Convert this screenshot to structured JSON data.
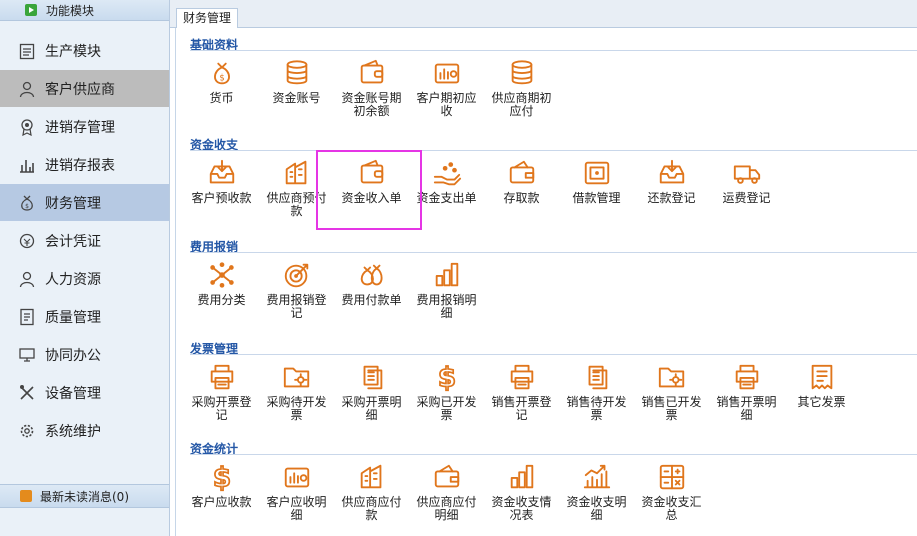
{
  "sidebar": {
    "header": "功能模块",
    "items": [
      {
        "label": "生产模块",
        "icon": "clipboard-icon"
      },
      {
        "label": "客户供应商",
        "icon": "person-icon"
      },
      {
        "label": "进销存管理",
        "icon": "medal-icon"
      },
      {
        "label": "进销存报表",
        "icon": "chart-icon"
      },
      {
        "label": "财务管理",
        "icon": "money-bag-icon"
      },
      {
        "label": "会计凭证",
        "icon": "coin-icon"
      },
      {
        "label": "人力资源",
        "icon": "person-icon"
      },
      {
        "label": "质量管理",
        "icon": "document-icon"
      },
      {
        "label": "协同办公",
        "icon": "monitor-icon"
      },
      {
        "label": "设备管理",
        "icon": "tools-icon"
      },
      {
        "label": "系统维护",
        "icon": "gear-icon"
      }
    ],
    "footer": "最新未读消息(0)"
  },
  "tab": {
    "label": "财务管理"
  },
  "sections": [
    {
      "title": "基础资料",
      "items": [
        {
          "line1": "货币",
          "line2": "",
          "icon": "money-bag-icon"
        },
        {
          "line1": "资金账号",
          "line2": "",
          "icon": "coin-stack-icon"
        },
        {
          "line1": "资金账号期",
          "line2": "初余额",
          "icon": "wallet-icon"
        },
        {
          "line1": "客户期初应",
          "line2": "收",
          "icon": "wallet-chart-icon"
        },
        {
          "line1": "供应商期初",
          "line2": "应付",
          "icon": "coin-stack-icon"
        }
      ]
    },
    {
      "title": "资金收支",
      "items": [
        {
          "line1": "客户预收款",
          "line2": "",
          "icon": "inbox-download-icon"
        },
        {
          "line1": "供应商预付",
          "line2": "款",
          "icon": "building-chart-icon"
        },
        {
          "line1": "资金收入单",
          "line2": "",
          "icon": "wallet-icon"
        },
        {
          "line1": "资金支出单",
          "line2": "",
          "icon": "hand-coins-icon"
        },
        {
          "line1": "存取款",
          "line2": "",
          "icon": "wallet-arrow-icon"
        },
        {
          "line1": "借款管理",
          "line2": "",
          "icon": "safe-icon"
        },
        {
          "line1": "还款登记",
          "line2": "",
          "icon": "inbox-download-icon"
        },
        {
          "line1": "运费登记",
          "line2": "",
          "icon": "truck-icon"
        }
      ]
    },
    {
      "title": "费用报销",
      "items": [
        {
          "line1": "费用分类",
          "line2": "",
          "icon": "network-icon"
        },
        {
          "line1": "费用报销登",
          "line2": "记",
          "icon": "target-icon"
        },
        {
          "line1": "费用付款单",
          "line2": "",
          "icon": "money-bags-icon"
        },
        {
          "line1": "费用报销明",
          "line2": "细",
          "icon": "bar-chart-icon"
        }
      ]
    },
    {
      "title": "发票管理",
      "items": [
        {
          "line1": "采购开票登",
          "line2": "记",
          "icon": "printer-icon"
        },
        {
          "line1": "采购待开发",
          "line2": "票",
          "icon": "folder-gear-icon"
        },
        {
          "line1": "采购开票明",
          "line2": "细",
          "icon": "documents-icon"
        },
        {
          "line1": "采购已开发",
          "line2": "票",
          "icon": "dollar-icon"
        },
        {
          "line1": "销售开票登",
          "line2": "记",
          "icon": "printer-icon"
        },
        {
          "line1": "销售待开发",
          "line2": "票",
          "icon": "documents-icon"
        },
        {
          "line1": "销售已开发",
          "line2": "票",
          "icon": "folder-gear-icon"
        },
        {
          "line1": "销售开票明",
          "line2": "细",
          "icon": "printer-icon"
        },
        {
          "line1": "其它发票",
          "line2": "",
          "icon": "receipt-icon"
        }
      ]
    },
    {
      "title": "资金统计",
      "items": [
        {
          "line1": "客户应收款",
          "line2": "",
          "icon": "dollar-icon"
        },
        {
          "line1": "客户应收明",
          "line2": "细",
          "icon": "wallet-chart-icon"
        },
        {
          "line1": "供应商应付",
          "line2": "款",
          "icon": "building-chart-icon"
        },
        {
          "line1": "供应商应付",
          "line2": "明细",
          "icon": "wallet-arrow-icon"
        },
        {
          "line1": "资金收支情",
          "line2": "况表",
          "icon": "bar-chart-icon"
        },
        {
          "line1": "资金收支明",
          "line2": "细",
          "icon": "line-chart-icon"
        },
        {
          "line1": "资金收支汇",
          "line2": "总",
          "icon": "calculator-icon"
        }
      ]
    }
  ],
  "colors": {
    "accent": "#e0761c",
    "section_title": "#2457a6",
    "highlight": "#e535e5"
  }
}
